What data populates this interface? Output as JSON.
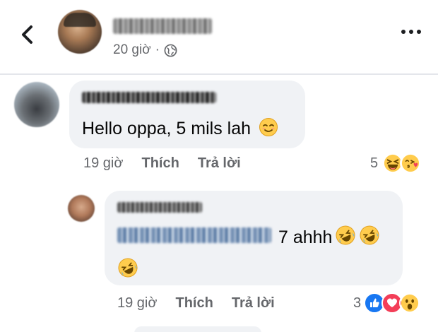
{
  "post": {
    "time": "20 giờ",
    "separator": "·"
  },
  "comments": [
    {
      "text": "Hello oppa, 5 mils lah",
      "time": "19 giờ",
      "like_label": "Thích",
      "reply_label": "Trả lời",
      "reaction_count": "5",
      "reactions": [
        "laughing-squint-icon",
        "kiss-heart-icon"
      ]
    },
    {
      "text": "7 ahhh",
      "time": "19 giờ",
      "like_label": "Thích",
      "reply_label": "Trả lời",
      "reaction_count": "3",
      "reactions": [
        "like-icon",
        "heart-icon",
        "wow-icon"
      ]
    }
  ],
  "colors": {
    "bubble": "#f0f2f5",
    "meta_text": "#65676b",
    "like_blue": "#1877f2",
    "love_red": "#f33e58",
    "emoji_yellow": "#ffcc4d"
  }
}
